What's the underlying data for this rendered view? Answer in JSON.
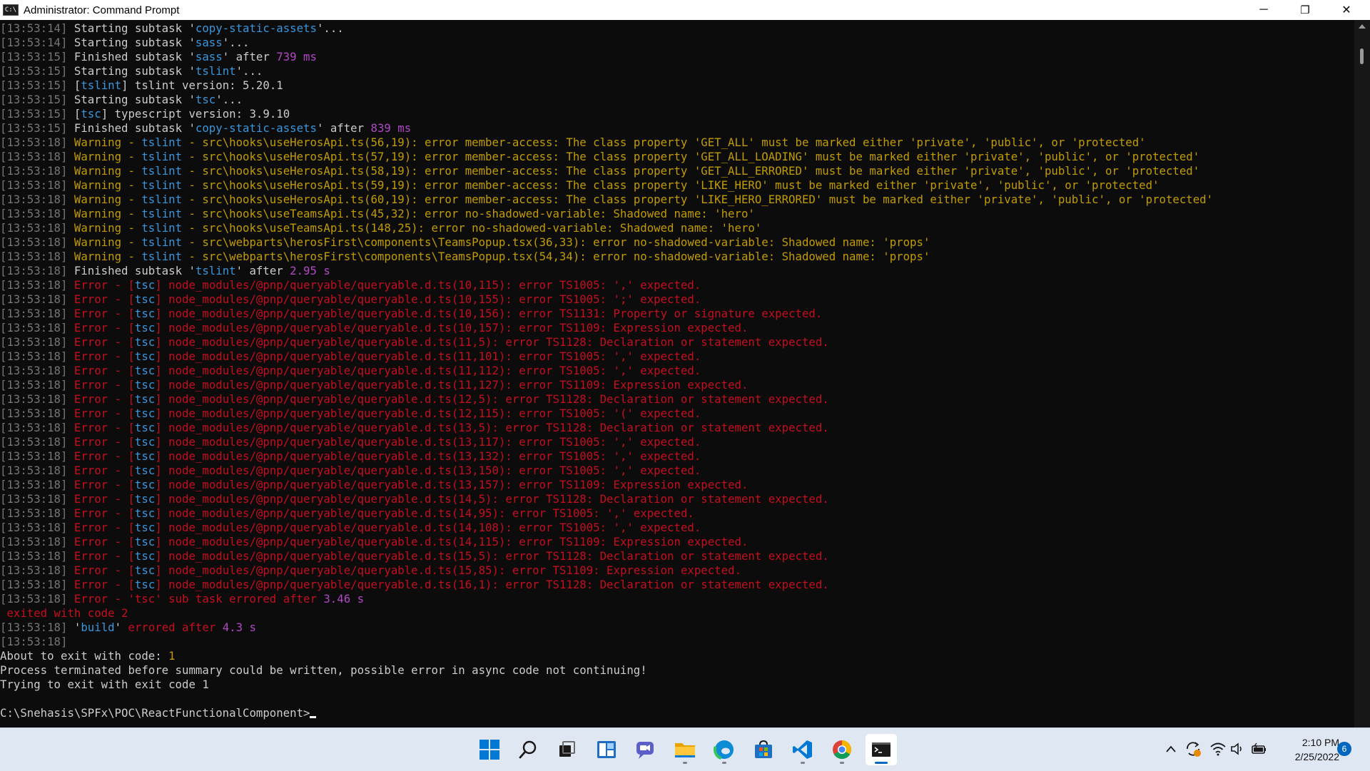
{
  "window": {
    "title": "Administrator: Command Prompt",
    "icon_label": "C:\\",
    "controls": {
      "minimize": "─",
      "restore": "❐",
      "close": "✕"
    }
  },
  "console": {
    "lines": [
      [
        [
          "t",
          "[13:53:14] "
        ],
        [
          "w",
          "Starting subtask '"
        ],
        [
          "c",
          "copy-static-assets"
        ],
        [
          "w",
          "'..."
        ]
      ],
      [
        [
          "t",
          "[13:53:14] "
        ],
        [
          "w",
          "Starting subtask '"
        ],
        [
          "c",
          "sass"
        ],
        [
          "w",
          "'..."
        ]
      ],
      [
        [
          "t",
          "[13:53:15] "
        ],
        [
          "w",
          "Finished subtask '"
        ],
        [
          "c",
          "sass"
        ],
        [
          "w",
          "' after "
        ],
        [
          "m",
          "739 ms"
        ]
      ],
      [
        [
          "t",
          "[13:53:15] "
        ],
        [
          "w",
          "Starting subtask '"
        ],
        [
          "c",
          "tslint"
        ],
        [
          "w",
          "'..."
        ]
      ],
      [
        [
          "t",
          "[13:53:15] "
        ],
        [
          "w",
          "["
        ],
        [
          "c",
          "tslint"
        ],
        [
          "w",
          "] tslint version: 5.20.1"
        ]
      ],
      [
        [
          "t",
          "[13:53:15] "
        ],
        [
          "w",
          "Starting subtask '"
        ],
        [
          "c",
          "tsc"
        ],
        [
          "w",
          "'..."
        ]
      ],
      [
        [
          "t",
          "[13:53:15] "
        ],
        [
          "w",
          "["
        ],
        [
          "c",
          "tsc"
        ],
        [
          "w",
          "] typescript version: 3.9.10"
        ]
      ],
      [
        [
          "t",
          "[13:53:15] "
        ],
        [
          "w",
          "Finished subtask '"
        ],
        [
          "c",
          "copy-static-assets"
        ],
        [
          "w",
          "' after "
        ],
        [
          "m",
          "839 ms"
        ]
      ],
      [
        [
          "t",
          "[13:53:18] "
        ],
        [
          "y",
          "Warning - "
        ],
        [
          "c",
          "tslint"
        ],
        [
          "y",
          " - src\\hooks\\useHerosApi.ts(56,19): error member-access: The class property 'GET_ALL' must be marked either 'private', 'public', or 'protected'"
        ]
      ],
      [
        [
          "t",
          "[13:53:18] "
        ],
        [
          "y",
          "Warning - "
        ],
        [
          "c",
          "tslint"
        ],
        [
          "y",
          " - src\\hooks\\useHerosApi.ts(57,19): error member-access: The class property 'GET_ALL_LOADING' must be marked either 'private', 'public', or 'protected'"
        ]
      ],
      [
        [
          "t",
          "[13:53:18] "
        ],
        [
          "y",
          "Warning - "
        ],
        [
          "c",
          "tslint"
        ],
        [
          "y",
          " - src\\hooks\\useHerosApi.ts(58,19): error member-access: The class property 'GET_ALL_ERRORED' must be marked either 'private', 'public', or 'protected'"
        ]
      ],
      [
        [
          "t",
          "[13:53:18] "
        ],
        [
          "y",
          "Warning - "
        ],
        [
          "c",
          "tslint"
        ],
        [
          "y",
          " - src\\hooks\\useHerosApi.ts(59,19): error member-access: The class property 'LIKE_HERO' must be marked either 'private', 'public', or 'protected'"
        ]
      ],
      [
        [
          "t",
          "[13:53:18] "
        ],
        [
          "y",
          "Warning - "
        ],
        [
          "c",
          "tslint"
        ],
        [
          "y",
          " - src\\hooks\\useHerosApi.ts(60,19): error member-access: The class property 'LIKE_HERO_ERRORED' must be marked either 'private', 'public', or 'protected'"
        ]
      ],
      [
        [
          "t",
          "[13:53:18] "
        ],
        [
          "y",
          "Warning - "
        ],
        [
          "c",
          "tslint"
        ],
        [
          "y",
          " - src\\hooks\\useTeamsApi.ts(45,32): error no-shadowed-variable: Shadowed name: 'hero'"
        ]
      ],
      [
        [
          "t",
          "[13:53:18] "
        ],
        [
          "y",
          "Warning - "
        ],
        [
          "c",
          "tslint"
        ],
        [
          "y",
          " - src\\hooks\\useTeamsApi.ts(148,25): error no-shadowed-variable: Shadowed name: 'hero'"
        ]
      ],
      [
        [
          "t",
          "[13:53:18] "
        ],
        [
          "y",
          "Warning - "
        ],
        [
          "c",
          "tslint"
        ],
        [
          "y",
          " - src\\webparts\\herosFirst\\components\\TeamsPopup.tsx(36,33): error no-shadowed-variable: Shadowed name: 'props'"
        ]
      ],
      [
        [
          "t",
          "[13:53:18] "
        ],
        [
          "y",
          "Warning - "
        ],
        [
          "c",
          "tslint"
        ],
        [
          "y",
          " - src\\webparts\\herosFirst\\components\\TeamsPopup.tsx(54,34): error no-shadowed-variable: Shadowed name: 'props'"
        ]
      ],
      [
        [
          "t",
          "[13:53:18] "
        ],
        [
          "w",
          "Finished subtask '"
        ],
        [
          "c",
          "tslint"
        ],
        [
          "w",
          "' after "
        ],
        [
          "m",
          "2.95 s"
        ]
      ],
      [
        [
          "t",
          "[13:53:18] "
        ],
        [
          "r",
          "Error - ["
        ],
        [
          "c",
          "tsc"
        ],
        [
          "r",
          "] node_modules/@pnp/queryable/queryable.d.ts(10,115): error TS1005: ',' expected."
        ]
      ],
      [
        [
          "t",
          "[13:53:18] "
        ],
        [
          "r",
          "Error - ["
        ],
        [
          "c",
          "tsc"
        ],
        [
          "r",
          "] node_modules/@pnp/queryable/queryable.d.ts(10,155): error TS1005: ';' expected."
        ]
      ],
      [
        [
          "t",
          "[13:53:18] "
        ],
        [
          "r",
          "Error - ["
        ],
        [
          "c",
          "tsc"
        ],
        [
          "r",
          "] node_modules/@pnp/queryable/queryable.d.ts(10,156): error TS1131: Property or signature expected."
        ]
      ],
      [
        [
          "t",
          "[13:53:18] "
        ],
        [
          "r",
          "Error - ["
        ],
        [
          "c",
          "tsc"
        ],
        [
          "r",
          "] node_modules/@pnp/queryable/queryable.d.ts(10,157): error TS1109: Expression expected."
        ]
      ],
      [
        [
          "t",
          "[13:53:18] "
        ],
        [
          "r",
          "Error - ["
        ],
        [
          "c",
          "tsc"
        ],
        [
          "r",
          "] node_modules/@pnp/queryable/queryable.d.ts(11,5): error TS1128: Declaration or statement expected."
        ]
      ],
      [
        [
          "t",
          "[13:53:18] "
        ],
        [
          "r",
          "Error - ["
        ],
        [
          "c",
          "tsc"
        ],
        [
          "r",
          "] node_modules/@pnp/queryable/queryable.d.ts(11,101): error TS1005: ',' expected."
        ]
      ],
      [
        [
          "t",
          "[13:53:18] "
        ],
        [
          "r",
          "Error - ["
        ],
        [
          "c",
          "tsc"
        ],
        [
          "r",
          "] node_modules/@pnp/queryable/queryable.d.ts(11,112): error TS1005: ',' expected."
        ]
      ],
      [
        [
          "t",
          "[13:53:18] "
        ],
        [
          "r",
          "Error - ["
        ],
        [
          "c",
          "tsc"
        ],
        [
          "r",
          "] node_modules/@pnp/queryable/queryable.d.ts(11,127): error TS1109: Expression expected."
        ]
      ],
      [
        [
          "t",
          "[13:53:18] "
        ],
        [
          "r",
          "Error - ["
        ],
        [
          "c",
          "tsc"
        ],
        [
          "r",
          "] node_modules/@pnp/queryable/queryable.d.ts(12,5): error TS1128: Declaration or statement expected."
        ]
      ],
      [
        [
          "t",
          "[13:53:18] "
        ],
        [
          "r",
          "Error - ["
        ],
        [
          "c",
          "tsc"
        ],
        [
          "r",
          "] node_modules/@pnp/queryable/queryable.d.ts(12,115): error TS1005: '(' expected."
        ]
      ],
      [
        [
          "t",
          "[13:53:18] "
        ],
        [
          "r",
          "Error - ["
        ],
        [
          "c",
          "tsc"
        ],
        [
          "r",
          "] node_modules/@pnp/queryable/queryable.d.ts(13,5): error TS1128: Declaration or statement expected."
        ]
      ],
      [
        [
          "t",
          "[13:53:18] "
        ],
        [
          "r",
          "Error - ["
        ],
        [
          "c",
          "tsc"
        ],
        [
          "r",
          "] node_modules/@pnp/queryable/queryable.d.ts(13,117): error TS1005: ',' expected."
        ]
      ],
      [
        [
          "t",
          "[13:53:18] "
        ],
        [
          "r",
          "Error - ["
        ],
        [
          "c",
          "tsc"
        ],
        [
          "r",
          "] node_modules/@pnp/queryable/queryable.d.ts(13,132): error TS1005: ',' expected."
        ]
      ],
      [
        [
          "t",
          "[13:53:18] "
        ],
        [
          "r",
          "Error - ["
        ],
        [
          "c",
          "tsc"
        ],
        [
          "r",
          "] node_modules/@pnp/queryable/queryable.d.ts(13,150): error TS1005: ',' expected."
        ]
      ],
      [
        [
          "t",
          "[13:53:18] "
        ],
        [
          "r",
          "Error - ["
        ],
        [
          "c",
          "tsc"
        ],
        [
          "r",
          "] node_modules/@pnp/queryable/queryable.d.ts(13,157): error TS1109: Expression expected."
        ]
      ],
      [
        [
          "t",
          "[13:53:18] "
        ],
        [
          "r",
          "Error - ["
        ],
        [
          "c",
          "tsc"
        ],
        [
          "r",
          "] node_modules/@pnp/queryable/queryable.d.ts(14,5): error TS1128: Declaration or statement expected."
        ]
      ],
      [
        [
          "t",
          "[13:53:18] "
        ],
        [
          "r",
          "Error - ["
        ],
        [
          "c",
          "tsc"
        ],
        [
          "r",
          "] node_modules/@pnp/queryable/queryable.d.ts(14,95): error TS1005: ',' expected."
        ]
      ],
      [
        [
          "t",
          "[13:53:18] "
        ],
        [
          "r",
          "Error - ["
        ],
        [
          "c",
          "tsc"
        ],
        [
          "r",
          "] node_modules/@pnp/queryable/queryable.d.ts(14,108): error TS1005: ',' expected."
        ]
      ],
      [
        [
          "t",
          "[13:53:18] "
        ],
        [
          "r",
          "Error - ["
        ],
        [
          "c",
          "tsc"
        ],
        [
          "r",
          "] node_modules/@pnp/queryable/queryable.d.ts(14,115): error TS1109: Expression expected."
        ]
      ],
      [
        [
          "t",
          "[13:53:18] "
        ],
        [
          "r",
          "Error - ["
        ],
        [
          "c",
          "tsc"
        ],
        [
          "r",
          "] node_modules/@pnp/queryable/queryable.d.ts(15,5): error TS1128: Declaration or statement expected."
        ]
      ],
      [
        [
          "t",
          "[13:53:18] "
        ],
        [
          "r",
          "Error - ["
        ],
        [
          "c",
          "tsc"
        ],
        [
          "r",
          "] node_modules/@pnp/queryable/queryable.d.ts(15,85): error TS1109: Expression expected."
        ]
      ],
      [
        [
          "t",
          "[13:53:18] "
        ],
        [
          "r",
          "Error - ["
        ],
        [
          "c",
          "tsc"
        ],
        [
          "r",
          "] node_modules/@pnp/queryable/queryable.d.ts(16,1): error TS1128: Declaration or statement expected."
        ]
      ],
      [
        [
          "t",
          "[13:53:18] "
        ],
        [
          "r",
          "Error - 'tsc' sub task errored after "
        ],
        [
          "m",
          "3.46 s"
        ]
      ],
      [
        [
          "r",
          " exited with code 2"
        ]
      ],
      [
        [
          "t",
          "[13:53:18] "
        ],
        [
          "w",
          "'"
        ],
        [
          "c",
          "build"
        ],
        [
          "w",
          "' "
        ],
        [
          "r",
          "errored after "
        ],
        [
          "m",
          "4.3 s"
        ]
      ],
      [
        [
          "t",
          "[13:53:18]"
        ]
      ],
      [
        [
          "w",
          "About to exit with code: "
        ],
        [
          "y",
          "1"
        ]
      ],
      [
        [
          "w",
          "Process terminated before summary could be written, possible error in async code not continuing!"
        ]
      ],
      [
        [
          "w",
          "Trying to exit with exit code 1"
        ]
      ],
      [
        [
          "w",
          ""
        ]
      ],
      [
        [
          "w",
          "C:\\Snehasis\\SPFx\\POC\\ReactFunctionalComponent>"
        ]
      ]
    ]
  },
  "colors": {
    "timestamp": "#767676",
    "cyan": "#3a96dd",
    "magenta": "#b148c6",
    "yellow": "#c19c00",
    "red": "#c50f1f",
    "text": "#cccccc",
    "background": "#0c0c0c",
    "taskbar": "#dfe7f3",
    "accent": "#0067c0"
  },
  "taskbar": {
    "apps": [
      {
        "name": "start-icon",
        "running": false,
        "active": false
      },
      {
        "name": "search-icon",
        "running": false,
        "active": false
      },
      {
        "name": "task-view-icon",
        "running": false,
        "active": false
      },
      {
        "name": "widgets-icon",
        "running": false,
        "active": false
      },
      {
        "name": "teams-chat-icon",
        "running": false,
        "active": false
      },
      {
        "name": "file-explorer-icon",
        "running": true,
        "active": false
      },
      {
        "name": "edge-icon",
        "running": true,
        "active": false
      },
      {
        "name": "store-icon",
        "running": false,
        "active": false
      },
      {
        "name": "vscode-icon",
        "running": true,
        "active": false
      },
      {
        "name": "chrome-icon",
        "running": true,
        "active": false
      },
      {
        "name": "terminal-icon",
        "running": true,
        "active": true
      }
    ],
    "tray_icons": [
      "chevron-up-icon",
      "sync-icon",
      "wifi-icon",
      "volume-icon",
      "battery-icon"
    ],
    "time": "2:10 PM",
    "date": "2/25/2022",
    "notification_count": "6"
  }
}
